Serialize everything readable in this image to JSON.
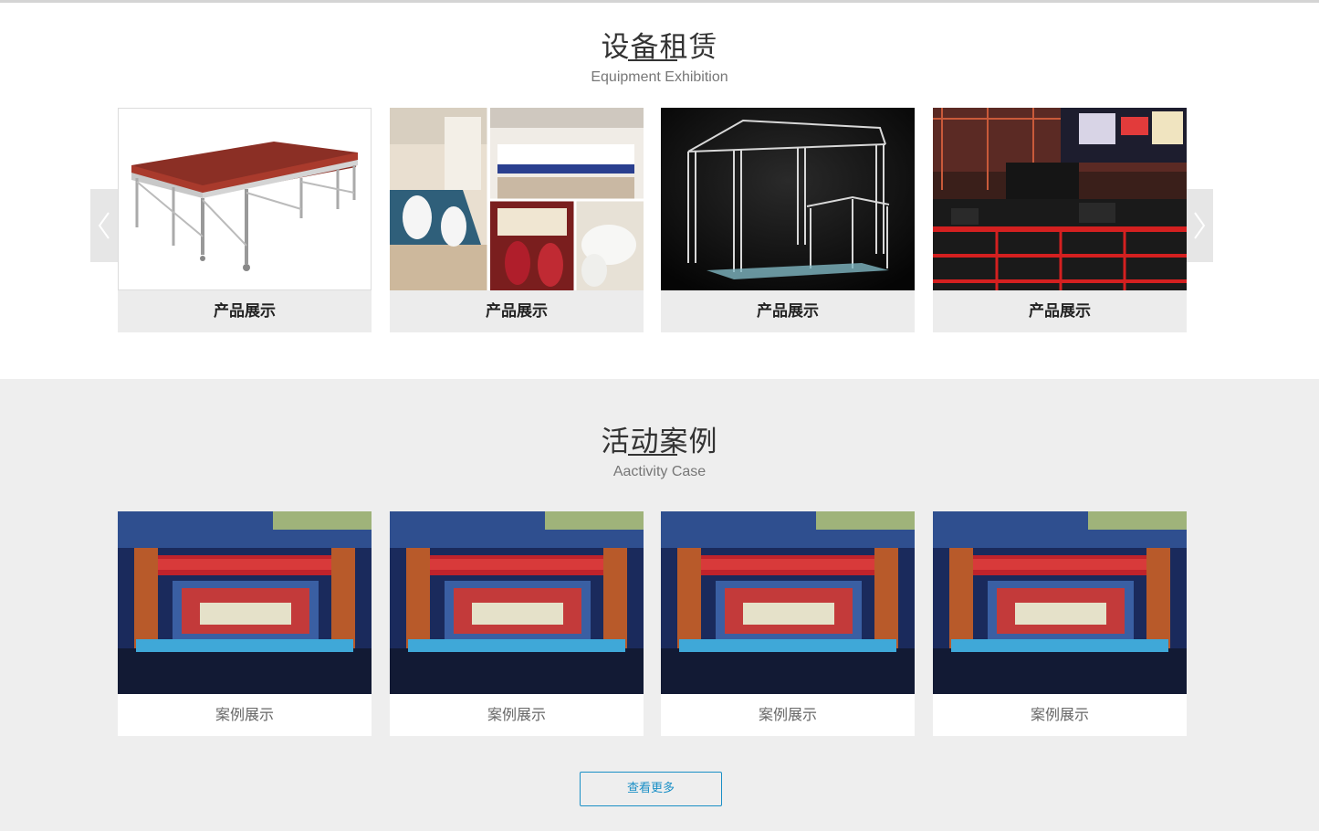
{
  "equipment": {
    "title": "设备租赁",
    "subtitle": "Equipment Exhibition",
    "items": [
      {
        "caption": "产品展示",
        "image": "stage-platform-image"
      },
      {
        "caption": "产品展示",
        "image": "banquet-collage-image"
      },
      {
        "caption": "产品展示",
        "image": "truss-frame-image"
      },
      {
        "caption": "产品展示",
        "image": "road-cases-image"
      }
    ],
    "prev_icon": "chevron-left-icon",
    "next_icon": "chevron-right-icon"
  },
  "cases": {
    "title": "活动案例",
    "subtitle": "Aactivity Case",
    "items": [
      {
        "caption": "案例展示",
        "image": "stage-event-image"
      },
      {
        "caption": "案例展示",
        "image": "stage-event-image"
      },
      {
        "caption": "案例展示",
        "image": "stage-event-image"
      },
      {
        "caption": "案例展示",
        "image": "stage-event-image"
      }
    ],
    "more_label": "查看更多"
  },
  "colors": {
    "accent": "#1a8fc6",
    "case_background": "#eeeeee",
    "caption_background": "#ececec"
  }
}
